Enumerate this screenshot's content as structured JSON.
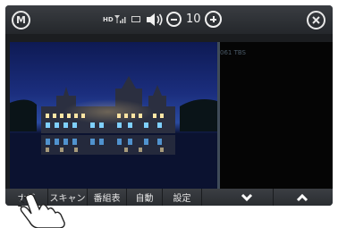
{
  "status_bar": {
    "menu_button_label": "M",
    "hd_label": "HD",
    "volume_value": "10",
    "close_icon": "close-icon"
  },
  "channel_panel": {
    "items": [
      "061 TBS"
    ]
  },
  "bottom_tabs": {
    "navi": "ナビ",
    "scan": "スキャン",
    "guide": "番組表",
    "auto": "自動",
    "settings": "設定"
  },
  "icons": {
    "signal": "signal-strength-icon",
    "battery": "battery-icon",
    "speaker": "speaker-icon",
    "volume_down": "minus-circle-icon",
    "volume_up": "plus-circle-icon",
    "down": "chevron-down-icon",
    "up": "chevron-up-icon",
    "hand": "pointing-hand-icon"
  },
  "colors": {
    "statusbar": "#2e3135",
    "panel": "#050505",
    "accent_divider": "#3f4b58"
  }
}
